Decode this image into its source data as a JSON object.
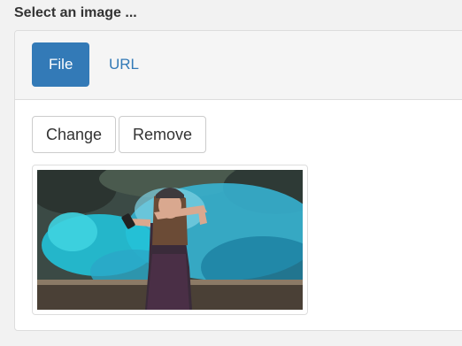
{
  "heading": "Select an image ...",
  "tabs": {
    "file_label": "File",
    "url_label": "URL",
    "active": "File"
  },
  "actions": {
    "change_label": "Change",
    "remove_label": "Remove"
  },
  "colors": {
    "primary": "#337ab7",
    "border": "#dddddd",
    "panel_header": "#f5f5f5"
  }
}
